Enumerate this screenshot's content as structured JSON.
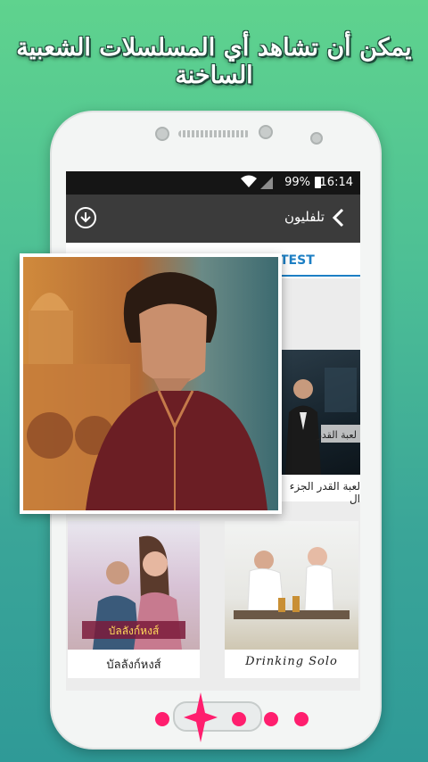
{
  "headline": "يمكن أن تشاهد أي المسلسلات الشعبية الساخنة",
  "status_bar": {
    "battery_percent": "99%",
    "time": "16:14"
  },
  "app_bar": {
    "title": "تلفليون",
    "back_icon": "chevron-left-icon",
    "download_icon": "download-circle-icon"
  },
  "tab": {
    "visible_label": "TEST"
  },
  "cards": [
    {
      "caption": "لعبة القدر الجزء ال",
      "poster_text": "لعبة القدر"
    },
    {
      "caption": "บัลลังก์หงส์",
      "poster_text": "บัลลังก์หงส์"
    },
    {
      "caption": "Drinking Solo",
      "poster_text": ""
    }
  ],
  "page_indicator": {
    "count": 5,
    "active_index": 1,
    "color": "#ff1e6e"
  },
  "colors": {
    "bg_top": "#5fd38e",
    "bg_bottom": "#2f9a97",
    "appbar": "#3b3b3b",
    "tab_accent": "#1d7fc4"
  }
}
